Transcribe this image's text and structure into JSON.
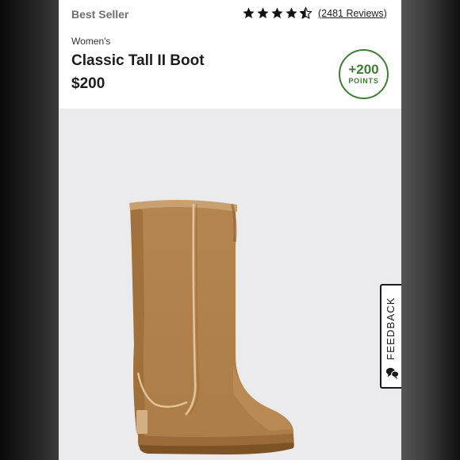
{
  "header": {
    "badge_text": "Best Seller",
    "rating": {
      "value": 4.5,
      "max": 5,
      "reviews_label": "(2481 Reviews)"
    },
    "category": "Women's",
    "product_name": "Classic Tall II Boot",
    "price": "$200",
    "points": {
      "value": "+200",
      "label": "POINTS",
      "color": "#3f7d33"
    }
  },
  "product_image": {
    "subject": "chestnut-suede-tall-boot",
    "color": "#b8874f"
  },
  "feedback_tab": {
    "label": "FEEDBACK",
    "icon": "chat-bubbles-icon"
  },
  "colors": {
    "page_bg": "#ebebed",
    "header_bg": "#ffffff",
    "text": "#1d1d1d",
    "muted": "#6f6f6f"
  }
}
